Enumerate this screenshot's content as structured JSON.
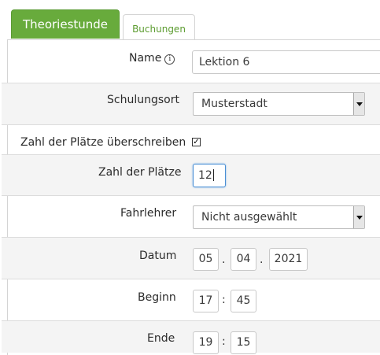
{
  "tabs": [
    {
      "label": "Theoriestunde",
      "active": true
    },
    {
      "label": "Buchungen",
      "active": false
    }
  ],
  "form": {
    "name": {
      "label": "Name",
      "value": "Lektion 6",
      "info_icon": "info-icon"
    },
    "location": {
      "label": "Schulungsort",
      "value": "Musterstadt"
    },
    "override": {
      "label": "Zahl der Plätze überschreiben",
      "checked": true,
      "mark": "✓"
    },
    "seats": {
      "label": "Zahl der Plätze",
      "value": "12"
    },
    "instructor": {
      "label": "Fahrlehrer",
      "value": "Nicht ausgewählt"
    },
    "date": {
      "label": "Datum",
      "day": "05",
      "month": "04",
      "year": "2021",
      "sep": "."
    },
    "start": {
      "label": "Beginn",
      "hour": "17",
      "minute": "45",
      "sep": ":"
    },
    "end": {
      "label": "Ende",
      "hour": "19",
      "minute": "15",
      "sep": ":"
    }
  },
  "colors": {
    "accent": "#68ab3c",
    "tab_text_inactive": "#5c9c30",
    "focus": "#4a8fd4"
  }
}
